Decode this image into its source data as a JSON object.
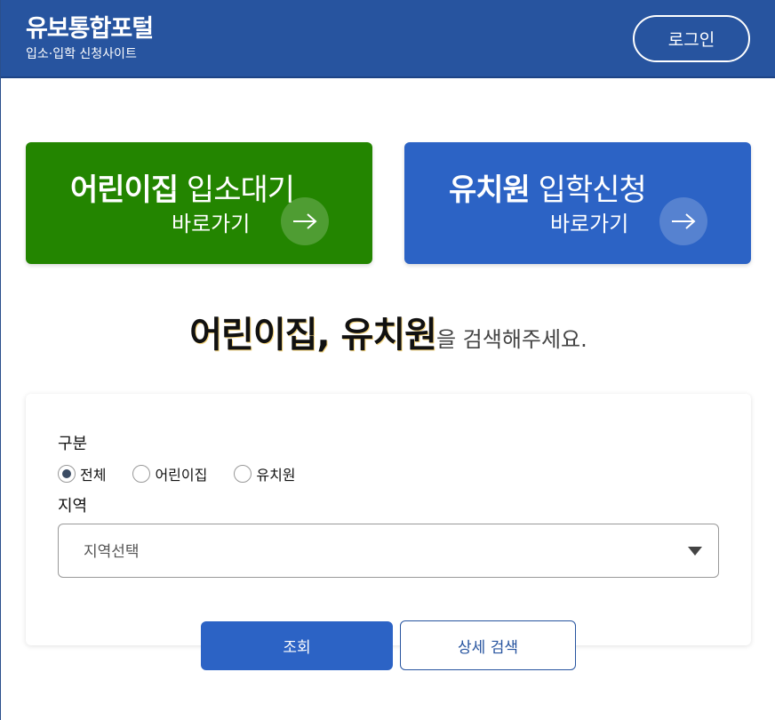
{
  "header": {
    "title": "유보통합포털",
    "subtitle": "입소·입학 신청사이트",
    "login_label": "로그인"
  },
  "cards": {
    "daycare": {
      "title_strong": "어린이집",
      "title_light": " 입소대기",
      "go_label": "바로가기"
    },
    "kinder": {
      "title_strong": "유치원",
      "title_light": " 입학신청",
      "go_label": "바로가기"
    }
  },
  "search_heading": {
    "strong": "어린이집, 유치원",
    "rest": "을 검색해주세요."
  },
  "search_panel": {
    "type_label": "구분",
    "type_options": [
      "전체",
      "어린이집",
      "유치원"
    ],
    "type_selected": "전체",
    "region_label": "지역",
    "region_placeholder": "지역선택"
  },
  "buttons": {
    "search_label": "조회",
    "detail_label": "상세 검색"
  },
  "colors": {
    "header_bg": "#27549f",
    "daycare_green": "#238500",
    "kinder_blue": "#2c63c5"
  },
  "icons": {
    "card_arrow": "arrow-right-icon",
    "select_caret": "caret-down-icon"
  }
}
